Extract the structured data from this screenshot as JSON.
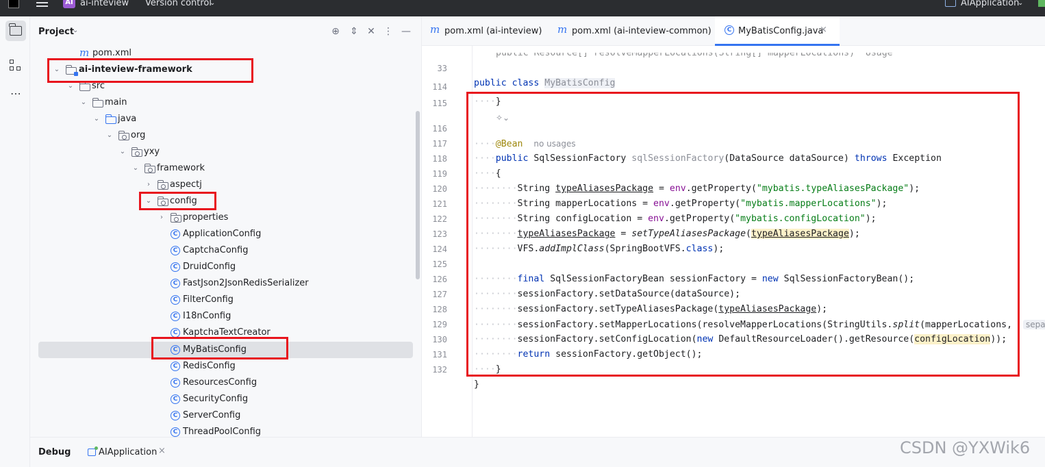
{
  "titlebar": {
    "project_badge": "AI",
    "project_name": "ai-inteview",
    "vcs_label": "Version control",
    "run_config": "AIApplication"
  },
  "project_panel": {
    "title": "Project",
    "tree": [
      {
        "label": "pom.xml",
        "icon": "maven-icon"
      },
      {
        "label": "ai-inteview-framework",
        "icon": "module-folder-icon",
        "expanded": true
      },
      {
        "label": "src",
        "icon": "folder-icon",
        "expanded": true
      },
      {
        "label": "main",
        "icon": "folder-icon",
        "expanded": true
      },
      {
        "label": "java",
        "icon": "source-root-icon",
        "expanded": true
      },
      {
        "label": "org",
        "icon": "package-icon",
        "expanded": true
      },
      {
        "label": "yxy",
        "icon": "package-icon",
        "expanded": true
      },
      {
        "label": "framework",
        "icon": "package-icon",
        "expanded": true
      },
      {
        "label": "aspectj",
        "icon": "package-icon",
        "expanded": false
      },
      {
        "label": "config",
        "icon": "package-icon",
        "expanded": true
      },
      {
        "label": "properties",
        "icon": "package-icon",
        "expanded": false
      },
      {
        "label": "ApplicationConfig",
        "icon": "class-icon"
      },
      {
        "label": "CaptchaConfig",
        "icon": "class-icon"
      },
      {
        "label": "DruidConfig",
        "icon": "class-icon"
      },
      {
        "label": "FastJson2JsonRedisSerializer",
        "icon": "class-icon"
      },
      {
        "label": "FilterConfig",
        "icon": "class-icon"
      },
      {
        "label": "I18nConfig",
        "icon": "class-icon"
      },
      {
        "label": "KaptchaTextCreator",
        "icon": "class-icon"
      },
      {
        "label": "MyBatisConfig",
        "icon": "class-icon",
        "selected": true
      },
      {
        "label": "RedisConfig",
        "icon": "class-icon"
      },
      {
        "label": "ResourcesConfig",
        "icon": "class-icon"
      },
      {
        "label": "SecurityConfig",
        "icon": "class-icon"
      },
      {
        "label": "ServerConfig",
        "icon": "class-icon"
      },
      {
        "label": "ThreadPoolConfig",
        "icon": "class-icon"
      }
    ]
  },
  "editor": {
    "tabs": [
      {
        "label": "pom.xml (ai-inteview)",
        "icon": "maven-icon"
      },
      {
        "label": "pom.xml (ai-inteview-common)",
        "icon": "maven-icon"
      },
      {
        "label": "MyBatisConfig.java",
        "icon": "class-icon",
        "active": true
      }
    ],
    "sticky": {
      "line": "33",
      "kw1": "public",
      "kw2": "class",
      "name": "MyBatisConfig"
    },
    "lines": {
      "l114": "114",
      "l115": "115",
      "l116": "116",
      "l117": "117",
      "l118": "118",
      "l119": "119",
      "l120": "120",
      "l121": "121",
      "l122": "122",
      "l123": "123",
      "l124": "124",
      "l125": "125",
      "l126": "126",
      "l127": "127",
      "l128": "128",
      "l129": "129",
      "l130": "130",
      "l131": "131",
      "l132": "132"
    },
    "code": {
      "brace_close": "}",
      "brace_open": "{",
      "annotation": "@Bean",
      "usages": "no usages",
      "public": "public",
      "ret_type": "SqlSessionFactory",
      "method_name": "sqlSessionFactory",
      "param_type": "DataSource",
      "param_name": "dataSource",
      "throws": "throws",
      "exception": "Exception",
      "string": "String",
      "var_alias": "typeAliasesPackage",
      "var_mapper": "mapperLocations",
      "var_config": "configLocation",
      "env": "env",
      "getprop": ".getProperty(",
      "str_alias": "\"mybatis.typeAliasesPackage\"",
      "str_mapper": "\"mybatis.mapperLocations\"",
      "str_config": "\"mybatis.configLocation\"",
      "close_semi": ");",
      "assign": " = ",
      "set_alias_fn": "setTypeAliasesPackage",
      "vfs": "VFS.",
      "add_impl": "addImplClass",
      "springboot_vfs": "(SpringBootVFS.",
      "class_kw": "class",
      "final": "final",
      "sfb_type": "SqlSessionFactoryBean",
      "sf_var": "sessionFactory",
      "new": "new",
      "sfb_ctor": "SqlSessionFactoryBean();",
      "set_ds": "sessionFactory.setDataSource(dataSource);",
      "set_alias_call": "sessionFactory.setTypeAliasesPackage(",
      "set_mapper_call": "sessionFactory.setMapperLocations(resolveMapperLocations(StringUtils.",
      "split": "split",
      "split_args": "(mapperLocations,",
      "inlay_sep": "sepa",
      "set_config_call": "sessionFactory.setConfigLocation(",
      "drl": "DefaultResourceLoader().getResource(",
      "close_dbl": "));",
      "return": "return",
      "get_object": "sessionFactory.getObject();",
      "ghost_line": "public Resource[] resolveMapperLocations(String[] mapperLocations)  Usage"
    }
  },
  "debugbar": {
    "title": "Debug",
    "tab_label": "AIApplication"
  },
  "watermark": "CSDN @YXWik6",
  "colors": {
    "accent": "#3574f0",
    "annotation_box": "#e8141d",
    "keyword": "#0033b3",
    "string": "#067d17"
  }
}
